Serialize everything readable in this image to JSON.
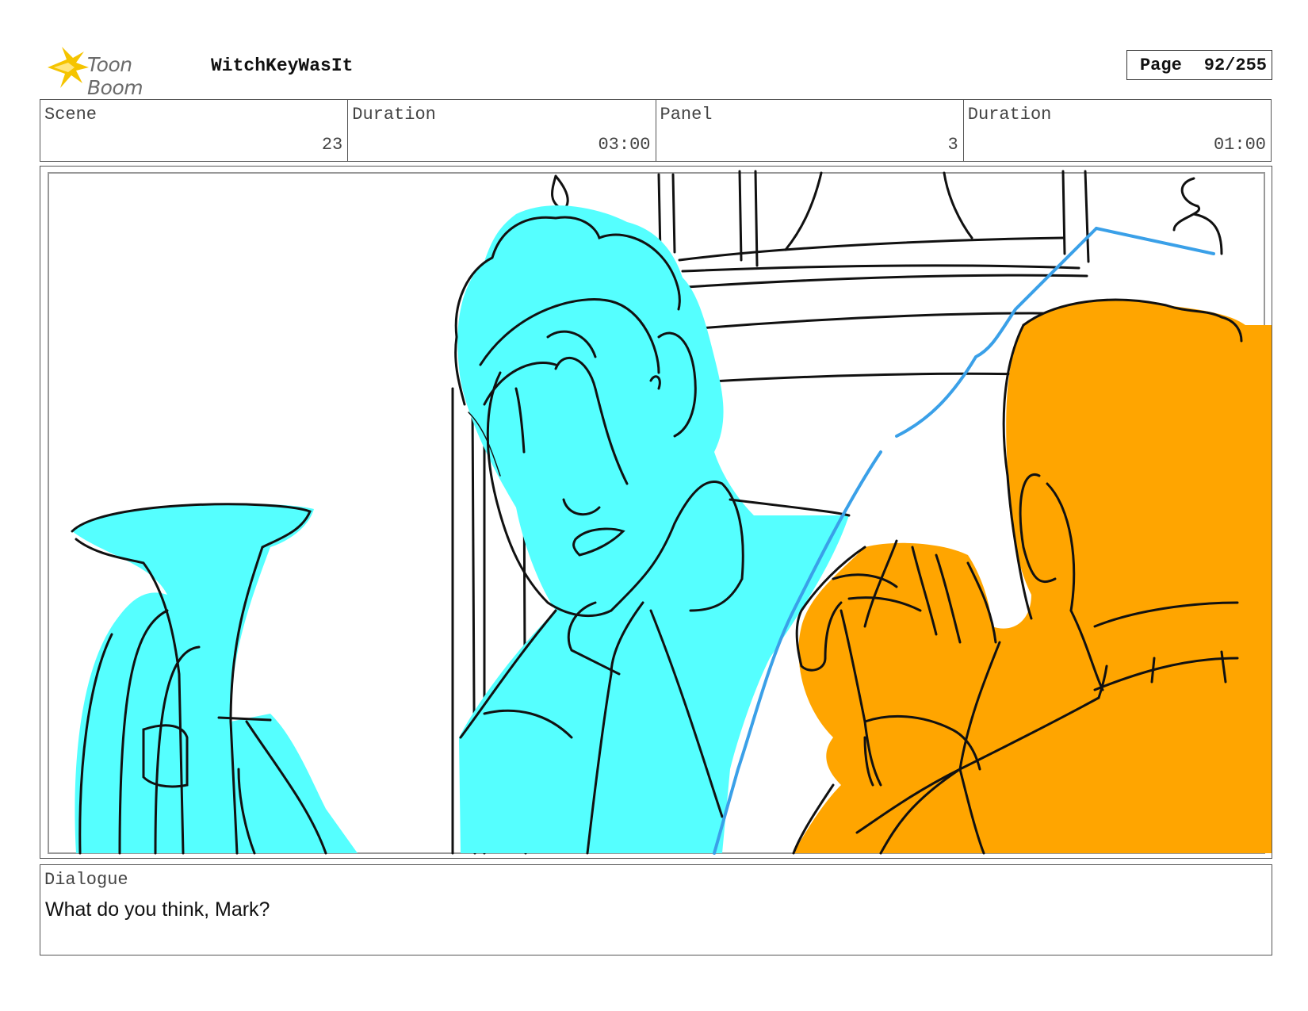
{
  "header": {
    "logo_text": "Toon Boom",
    "project_title": "WitchKeyWasIt",
    "page_label": "Page",
    "page_value": "92/255"
  },
  "info": {
    "scene_label": "Scene",
    "scene_value": "23",
    "scene_duration_label": "Duration",
    "scene_duration_value": "03:00",
    "panel_label": "Panel",
    "panel_value": "3",
    "panel_duration_label": "Duration",
    "panel_duration_value": "01:00"
  },
  "dialogue": {
    "label": "Dialogue",
    "text": "What do you think, Mark?"
  },
  "colors": {
    "cyan_character": "#55ffff",
    "orange_character": "#ffa500",
    "sketch_line": "#111111",
    "blue_line": "#3aa0e8",
    "logo_yellow": "#f5c400"
  }
}
